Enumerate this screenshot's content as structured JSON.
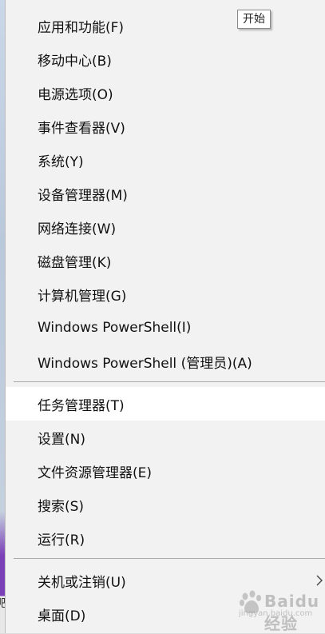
{
  "tooltip": {
    "text": "开始"
  },
  "menu": {
    "group1": [
      {
        "label": "应用和功能(F)"
      },
      {
        "label": "移动中心(B)"
      },
      {
        "label": "电源选项(O)"
      },
      {
        "label": "事件查看器(V)"
      },
      {
        "label": "系统(Y)"
      },
      {
        "label": "设备管理器(M)"
      },
      {
        "label": "网络连接(W)"
      },
      {
        "label": "磁盘管理(K)"
      },
      {
        "label": "计算机管理(G)"
      },
      {
        "label": "Windows PowerShell(I)"
      },
      {
        "label": "Windows PowerShell (管理员)(A)"
      }
    ],
    "group2": [
      {
        "label": "任务管理器(T)",
        "highlighted": true
      },
      {
        "label": "设置(N)"
      },
      {
        "label": "文件资源管理器(E)"
      },
      {
        "label": "搜索(S)"
      },
      {
        "label": "运行(R)"
      }
    ],
    "group3": [
      {
        "label": "关机或注销(U)",
        "has_submenu": true,
        "submenu_icon": "chevron-right-icon"
      },
      {
        "label": "桌面(D)"
      }
    ]
  },
  "watermark": {
    "text": "Baidu经验",
    "sub": "jingyan.baidu.com"
  },
  "colors": {
    "menu_background": "#f2f2f2",
    "highlight_background": "#ffffff",
    "separator": "#a9a9a9",
    "taskbar_accent": "#7b3fb8"
  }
}
